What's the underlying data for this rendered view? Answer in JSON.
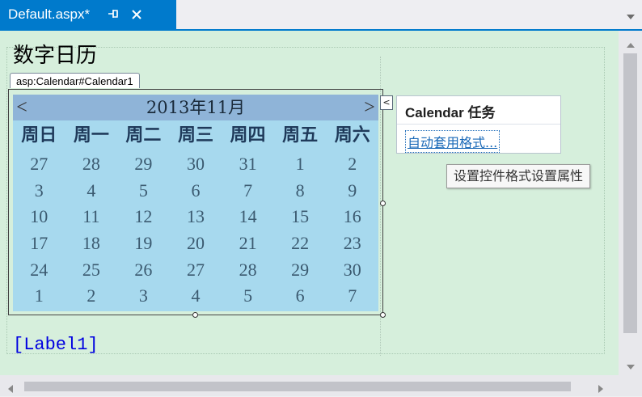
{
  "tab": {
    "title": "Default.aspx*",
    "pin_glyph": "−ɵ",
    "pin_icon": "pin-icon",
    "close_icon": "close-icon",
    "dropdown_icon": "chevron-down-icon"
  },
  "colors": {
    "accent": "#007acc",
    "surface": "#d6efdc",
    "calendar_bg": "#a7d9ee",
    "calendar_header": "#8fb4d8",
    "label_text": "#0000e0"
  },
  "page": {
    "heading": "数字日历",
    "control_tag": "asp:Calendar#Calendar1",
    "label": "[Label1]"
  },
  "calendar": {
    "prev": "<",
    "next": ">",
    "title": "2013年11月",
    "days_of_week": [
      "周日",
      "周一",
      "周二",
      "周三",
      "周四",
      "周五",
      "周六"
    ],
    "weeks": [
      [
        "27",
        "28",
        "29",
        "30",
        "31",
        "1",
        "2"
      ],
      [
        "3",
        "4",
        "5",
        "6",
        "7",
        "8",
        "9"
      ],
      [
        "10",
        "11",
        "12",
        "13",
        "14",
        "15",
        "16"
      ],
      [
        "17",
        "18",
        "19",
        "20",
        "21",
        "22",
        "23"
      ],
      [
        "24",
        "25",
        "26",
        "27",
        "28",
        "29",
        "30"
      ],
      [
        "1",
        "2",
        "3",
        "4",
        "5",
        "6",
        "7"
      ]
    ]
  },
  "smart_tag": {
    "button_glyph": "<",
    "title": "Calendar 任务",
    "link": "自动套用格式...",
    "tooltip": "设置控件格式设置属性"
  }
}
